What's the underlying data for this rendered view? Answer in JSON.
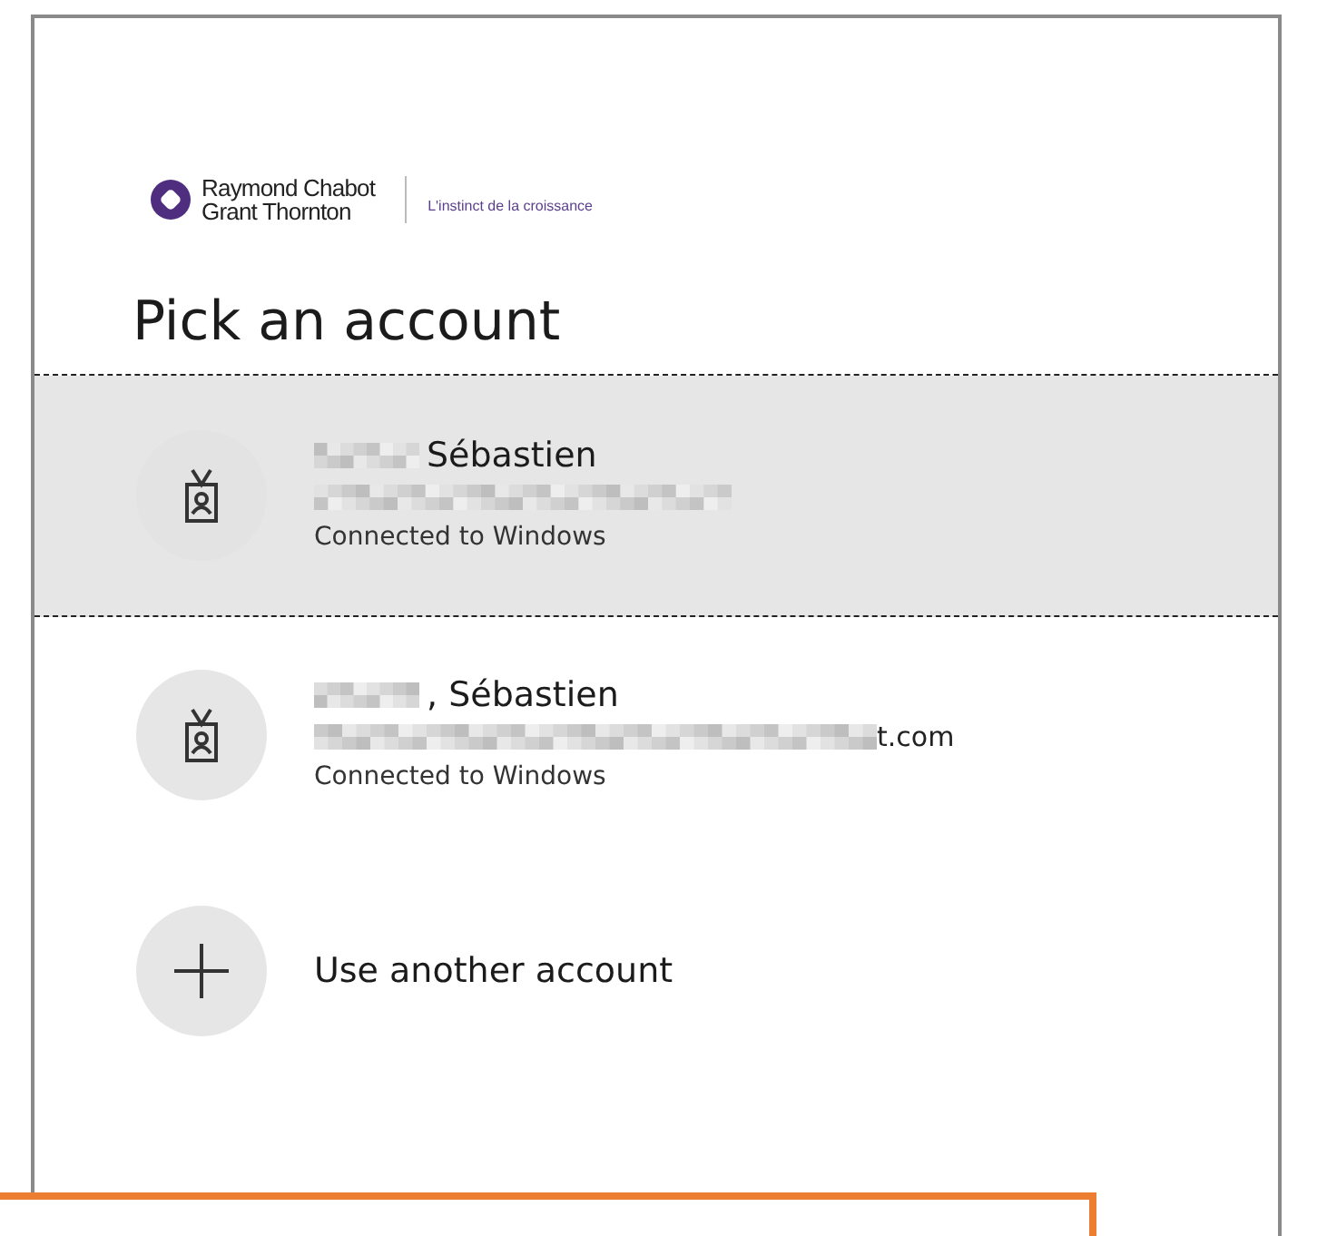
{
  "logo": {
    "name_lines": [
      "Raymond Chabot",
      "Grant Thornton"
    ],
    "tagline": "L'instinct de la croissance"
  },
  "heading": "Pick an account",
  "accounts": [
    {
      "kind": "account",
      "name": "Sébastien",
      "name_redacted": true,
      "email_redacted": true,
      "status": "Connected to Windows",
      "selected": true
    },
    {
      "kind": "account",
      "name": ", Sébastien",
      "name_redacted": true,
      "email": "t.com",
      "email_redacted": true,
      "status": "Connected to Windows",
      "selected": false
    },
    {
      "kind": "add",
      "label": "Use another account",
      "selected": false
    }
  ]
}
